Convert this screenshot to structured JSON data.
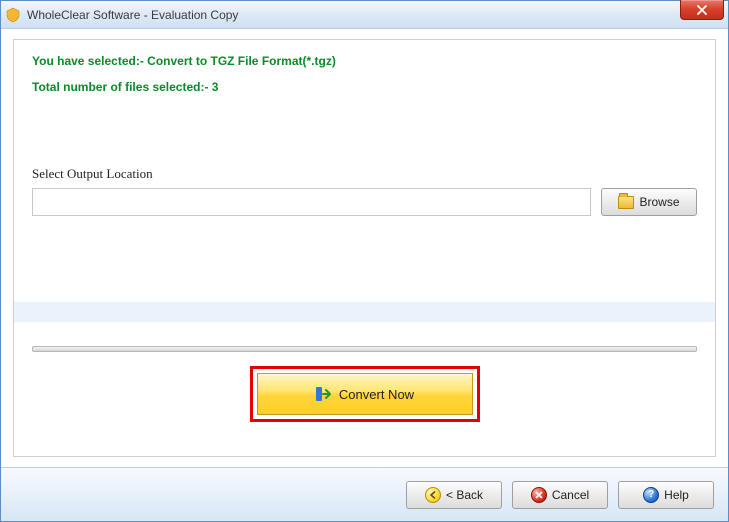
{
  "window": {
    "title": "WholeClear Software - Evaluation Copy"
  },
  "messages": {
    "selected": "You have selected:- Convert to TGZ File Format(*.tgz)",
    "file_count": "Total number of files selected:- 3"
  },
  "output": {
    "label": "Select Output Location",
    "value": "",
    "browse_label": "Browse"
  },
  "actions": {
    "convert_label": "Convert Now",
    "back_label": "< Back",
    "cancel_label": "Cancel",
    "help_label": "Help"
  }
}
